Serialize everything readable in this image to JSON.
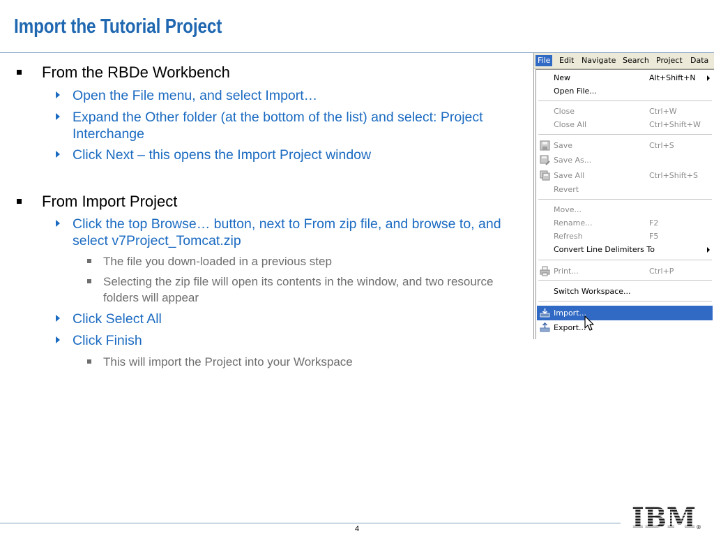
{
  "slide": {
    "title": "Import the Tutorial Project",
    "page_number": "4",
    "logo_text": "IBM",
    "registered_mark": "®"
  },
  "sections": [
    {
      "heading": "From the RBDe Workbench",
      "steps": [
        {
          "text": "Open the File menu, and select Import…"
        },
        {
          "text": "Expand the Other folder (at the bottom of the list) and select: Project Interchange"
        },
        {
          "text": "Click Next – this opens the Import Project window"
        }
      ]
    },
    {
      "heading": "From Import Project",
      "steps": [
        {
          "text": "Click the top Browse… button, next to From zip file, and browse to, and select v7Project_Tomcat.zip",
          "notes": [
            "The file you down-loaded in a previous step",
            "Selecting the zip file will open its contents in the window, and two resource folders will appear"
          ]
        },
        {
          "text": "Click Select All"
        },
        {
          "text": "Click Finish",
          "notes": [
            "This will import the Project into your Workspace"
          ]
        }
      ]
    }
  ],
  "menu_bar": [
    "File",
    "Edit",
    "Navigate",
    "Search",
    "Project",
    "Data"
  ],
  "file_menu": [
    {
      "label": "New",
      "shortcut": "Alt+Shift+N",
      "submenu": true,
      "enabled": true
    },
    {
      "label": "Open File...",
      "shortcut": "",
      "enabled": true
    },
    {
      "label": "Close",
      "shortcut": "Ctrl+W",
      "enabled": false
    },
    {
      "label": "Close All",
      "shortcut": "Ctrl+Shift+W",
      "enabled": false
    },
    {
      "label": "Save",
      "shortcut": "Ctrl+S",
      "enabled": false,
      "icon": "save-icon"
    },
    {
      "label": "Save As...",
      "shortcut": "",
      "enabled": false,
      "icon": "save-as-icon"
    },
    {
      "label": "Save All",
      "shortcut": "Ctrl+Shift+S",
      "enabled": false,
      "icon": "save-all-icon"
    },
    {
      "label": "Revert",
      "shortcut": "",
      "enabled": false
    },
    {
      "label": "Move...",
      "shortcut": "",
      "enabled": false
    },
    {
      "label": "Rename...",
      "shortcut": "F2",
      "enabled": false
    },
    {
      "label": "Refresh",
      "shortcut": "F5",
      "enabled": false
    },
    {
      "label": "Convert Line Delimiters To",
      "shortcut": "",
      "submenu": true,
      "enabled": true
    },
    {
      "label": "Print...",
      "shortcut": "Ctrl+P",
      "enabled": false,
      "icon": "printer-icon"
    },
    {
      "label": "Switch Workspace...",
      "shortcut": "",
      "enabled": true
    },
    {
      "label": "Import...",
      "shortcut": "",
      "enabled": true,
      "highlighted": true,
      "icon": "import-icon"
    },
    {
      "label": "Export...",
      "shortcut": "",
      "enabled": true,
      "icon": "export-icon"
    }
  ],
  "colors": {
    "title": "#1f67b0",
    "link_text": "#1a6ac1",
    "note_text": "#6e6e6e",
    "menu_highlight": "#316ac5",
    "menu_bar_bg": "#ece9d8"
  }
}
